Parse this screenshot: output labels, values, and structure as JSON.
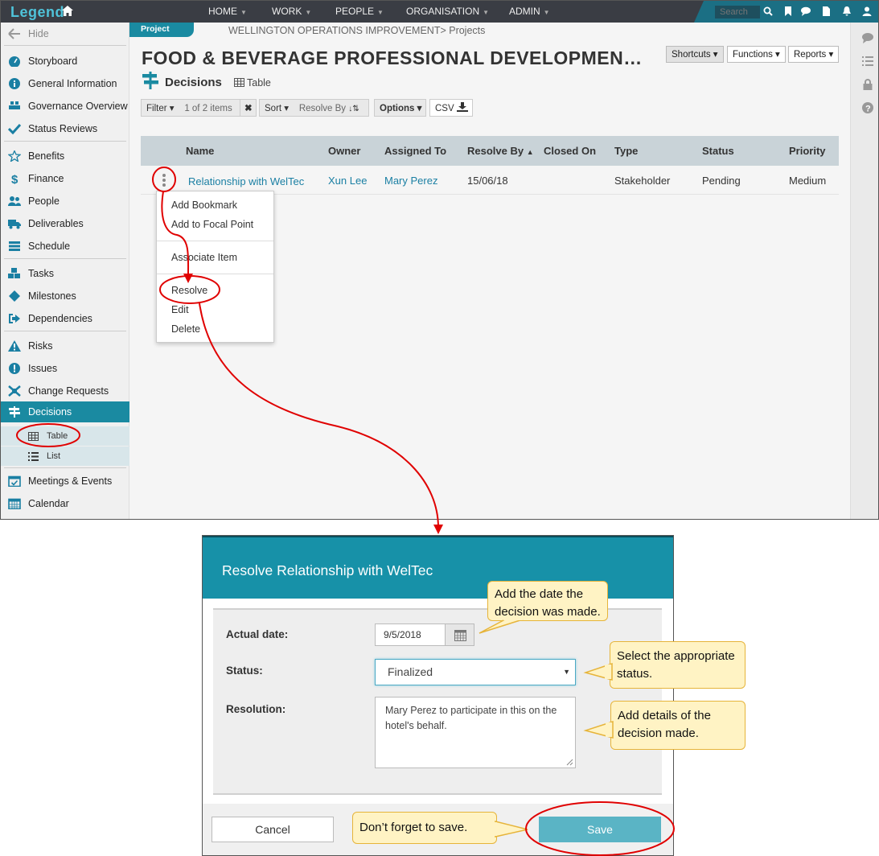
{
  "topbar": {
    "logo": "Legend",
    "nav": [
      {
        "label": "HOME"
      },
      {
        "label": "WORK"
      },
      {
        "label": "PEOPLE"
      },
      {
        "label": "ORGANISATION"
      },
      {
        "label": "ADMIN"
      }
    ],
    "search_placeholder": "Search"
  },
  "sidebar": {
    "hide_label": "Hide",
    "items": [
      {
        "label": "Storyboard",
        "icon": "dashboard-icon"
      },
      {
        "label": "General Information",
        "icon": "info-icon"
      },
      {
        "label": "Governance Overview",
        "icon": "governance-icon"
      },
      {
        "label": "Status Reviews",
        "icon": "check-icon"
      },
      {
        "label": "Benefits",
        "icon": "star-icon"
      },
      {
        "label": "Finance",
        "icon": "dollar-icon"
      },
      {
        "label": "People",
        "icon": "people-icon"
      },
      {
        "label": "Deliverables",
        "icon": "truck-icon"
      },
      {
        "label": "Schedule",
        "icon": "schedule-icon"
      },
      {
        "label": "Tasks",
        "icon": "cubes-icon"
      },
      {
        "label": "Milestones",
        "icon": "diamond-icon"
      },
      {
        "label": "Dependencies",
        "icon": "dependency-icon"
      },
      {
        "label": "Risks",
        "icon": "warning-icon"
      },
      {
        "label": "Issues",
        "icon": "exclamation-icon"
      },
      {
        "label": "Change Requests",
        "icon": "arrows-icon"
      },
      {
        "label": "Decisions",
        "icon": "signpost-icon"
      },
      {
        "label": "Meetings & Events",
        "icon": "calendar-check-icon"
      },
      {
        "label": "Calendar",
        "icon": "calendar-icon"
      }
    ],
    "sub_items": [
      {
        "label": "Table"
      },
      {
        "label": "List"
      }
    ]
  },
  "main": {
    "project_tag": "Project",
    "breadcrumb": "WELLINGTON OPERATIONS IMPROVEMENT> Projects",
    "title": "FOOD & BEVERAGE PROFESSIONAL DEVELOPMEN…",
    "top_buttons": [
      "Shortcuts",
      "Functions",
      "Reports"
    ],
    "section_title": "Decisions",
    "section_view": "Table",
    "toolbar": {
      "filter": "Filter",
      "count": "1 of 2 items",
      "sort": "Sort",
      "sort_by": "Resolve By",
      "options": "Options",
      "csv": "CSV"
    },
    "table": {
      "columns": [
        "Name",
        "Owner",
        "Assigned To",
        "Resolve By",
        "Closed On",
        "Type",
        "Status",
        "Priority"
      ],
      "rows": [
        {
          "name": "Relationship with WelTec",
          "owner": "Xun Lee",
          "assigned": "Mary Perez",
          "resolve_by": "15/06/18",
          "closed_on": "",
          "type": "Stakeholder",
          "status": "Pending",
          "priority": "Medium"
        }
      ]
    },
    "context_menu": [
      "Add Bookmark",
      "Add to Focal Point",
      "Associate Item",
      "Resolve",
      "Edit",
      "Delete"
    ]
  },
  "dialog": {
    "title": "Resolve Relationship with WelTec",
    "actual_date_label": "Actual date:",
    "actual_date_value": "9/5/2018",
    "status_label": "Status:",
    "status_value": "Finalized",
    "resolution_label": "Resolution:",
    "resolution_value": "Mary Perez to participate in this on the hotel's behalf.",
    "cancel_label": "Cancel",
    "save_label": "Save"
  },
  "callouts": {
    "date": "Add the date the decision was made.",
    "status": "Select the appropriate status.",
    "resolution": "Add details of the decision made.",
    "save": "Don’t forget to save."
  },
  "colors": {
    "accent": "#1a8aa1",
    "annotation": "#e00000",
    "callout_bg": "#fff3c4"
  }
}
